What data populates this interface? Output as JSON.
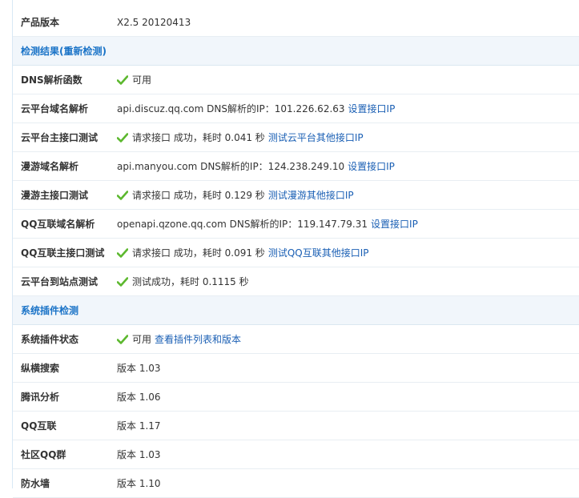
{
  "rows": [
    {
      "type": "row",
      "label": "产品版本",
      "value": "X2.5 20120413"
    },
    {
      "type": "section",
      "title": "检测结果(重新检测)"
    },
    {
      "type": "row",
      "label": "DNS解析函数",
      "check": true,
      "value": "可用"
    },
    {
      "type": "row",
      "label": "云平台域名解析",
      "value": "api.discuz.qq.com DNS解析的IP：101.226.62.63",
      "link": "设置接口IP"
    },
    {
      "type": "row",
      "label": "云平台主接口测试",
      "check": true,
      "value": "请求接口 成功，耗时 0.041 秒",
      "link": "测试云平台其他接口IP"
    },
    {
      "type": "row",
      "label": "漫游域名解析",
      "value": "api.manyou.com DNS解析的IP：124.238.249.10",
      "link": "设置接口IP"
    },
    {
      "type": "row",
      "label": "漫游主接口测试",
      "check": true,
      "value": "请求接口 成功，耗时 0.129 秒",
      "link": "测试漫游其他接口IP"
    },
    {
      "type": "row",
      "label": "QQ互联域名解析",
      "value": "openapi.qzone.qq.com DNS解析的IP：119.147.79.31",
      "link": "设置接口IP"
    },
    {
      "type": "row",
      "label": "QQ互联主接口测试",
      "check": true,
      "value": "请求接口 成功，耗时 0.091 秒",
      "link": "测试QQ互联其他接口IP"
    },
    {
      "type": "row",
      "label": "云平台到站点测试",
      "check": true,
      "value": "测试成功，耗时 0.1115 秒"
    },
    {
      "type": "section",
      "title": "系统插件检测"
    },
    {
      "type": "row",
      "label": "系统插件状态",
      "check": true,
      "value": "可用",
      "link": "查看插件列表和版本"
    },
    {
      "type": "row",
      "label": "纵横搜索",
      "value": "版本 1.03"
    },
    {
      "type": "row",
      "label": "腾讯分析",
      "value": "版本 1.06"
    },
    {
      "type": "row",
      "label": "QQ互联",
      "value": "版本 1.17"
    },
    {
      "type": "row",
      "label": "社区QQ群",
      "value": "版本 1.03"
    },
    {
      "type": "row",
      "label": "防水墙",
      "value": "版本 1.10"
    }
  ],
  "colors": {
    "check": "#5cb82e",
    "link": "#1a5fb4",
    "section_title": "#1a73c7"
  },
  "icons": {
    "check": "check-icon"
  }
}
